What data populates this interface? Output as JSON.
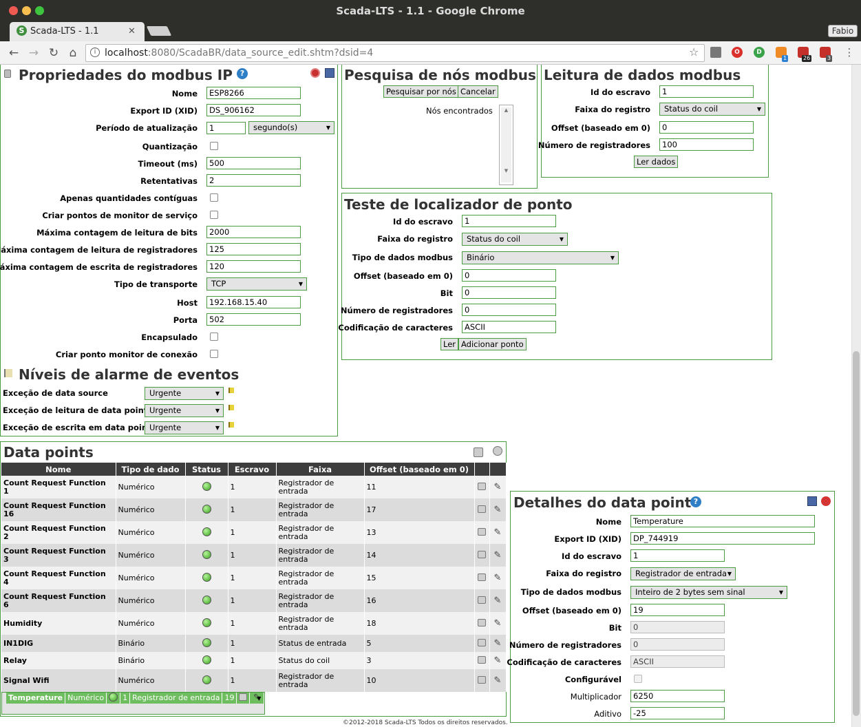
{
  "browser": {
    "window_title": "Scada-LTS - 1.1 - Google Chrome",
    "tab_title": "Scada-LTS - 1.1",
    "tab_favicon": "S",
    "user": "Fabio",
    "url_host": "localhost",
    "url_rest": ":8080/ScadaBR/data_source_edit.shtm?dsid=4",
    "extension_badges": [
      "1",
      "26",
      "3"
    ]
  },
  "props": {
    "title": "Propriedades do modbus IP",
    "fields": {
      "nome": {
        "label": "Nome",
        "value": "ESP8266"
      },
      "xid": {
        "label": "Export ID (XID)",
        "value": "DS_906162"
      },
      "periodo": {
        "label": "Período de atualização",
        "value": "1",
        "unit": "segundo(s)"
      },
      "quantizacao": {
        "label": "Quantização"
      },
      "timeout": {
        "label": "Timeout (ms)",
        "value": "500"
      },
      "retentativas": {
        "label": "Retentativas",
        "value": "2"
      },
      "contiguas": {
        "label": "Apenas quantidades contíguas"
      },
      "monitor": {
        "label": "Criar pontos de monitor de serviço"
      },
      "maxbits": {
        "label": "Máxima contagem de leitura de bits",
        "value": "2000"
      },
      "maxreg": {
        "label": "Máxima contagem de leitura de registradores",
        "value": "125"
      },
      "maxesc": {
        "label": "Máxima contagem de escrita de registradores",
        "value": "120"
      },
      "transporte": {
        "label": "Tipo de transporte",
        "value": "TCP"
      },
      "host": {
        "label": "Host",
        "value": "192.168.15.40"
      },
      "porta": {
        "label": "Porta",
        "value": "502"
      },
      "encapsulado": {
        "label": "Encapsulado"
      },
      "conexao": {
        "label": "Criar ponto monitor de conexão"
      }
    }
  },
  "alarms": {
    "title": "Níveis de alarme de eventos",
    "rows": [
      {
        "label": "Exceção de data source",
        "value": "Urgente"
      },
      {
        "label": "Exceção de leitura de data point",
        "value": "Urgente"
      },
      {
        "label": "Exceção de escrita em data point",
        "value": "Urgente"
      }
    ]
  },
  "search": {
    "title": "Pesquisa de nós modbus",
    "search_button": "Pesquisar por nós",
    "cancel_button": "Cancelar",
    "found_label": "Nós encontrados"
  },
  "read": {
    "title": "Leitura de dados modbus",
    "slave": {
      "label": "Id do escravo",
      "value": "1"
    },
    "range": {
      "label": "Faixa do registro",
      "value": "Status do coil"
    },
    "offset": {
      "label": "Offset (baseado em 0)",
      "value": "0"
    },
    "count": {
      "label": "Número de registradores",
      "value": "100"
    },
    "button": "Ler dados"
  },
  "locator": {
    "title": "Teste de localizador de ponto",
    "slave": {
      "label": "Id do escravo",
      "value": "1"
    },
    "range": {
      "label": "Faixa do registro",
      "value": "Status do coil"
    },
    "datatype": {
      "label": "Tipo de dados modbus",
      "value": "Binário"
    },
    "offset": {
      "label": "Offset (baseado em 0)",
      "value": "0"
    },
    "bit": {
      "label": "Bit",
      "value": "0"
    },
    "count": {
      "label": "Número de registradores",
      "value": "0"
    },
    "charset": {
      "label": "Codificação de caracteres",
      "value": "ASCII"
    },
    "read_button": "Ler",
    "add_button": "Adicionar ponto"
  },
  "datapoints": {
    "title": "Data points",
    "columns": [
      "Nome",
      "Tipo de dado",
      "Status",
      "Escravo",
      "Faixa",
      "Offset (baseado em 0)"
    ],
    "rows": [
      {
        "name": "Count Request Function 1",
        "type": "Numérico",
        "slave": "1",
        "range": "Registrador de entrada",
        "offset": "11"
      },
      {
        "name": "Count Request Function 16",
        "type": "Numérico",
        "slave": "1",
        "range": "Registrador de entrada",
        "offset": "17"
      },
      {
        "name": "Count Request Function 2",
        "type": "Numérico",
        "slave": "1",
        "range": "Registrador de entrada",
        "offset": "13"
      },
      {
        "name": "Count Request Function 3",
        "type": "Numérico",
        "slave": "1",
        "range": "Registrador de entrada",
        "offset": "14"
      },
      {
        "name": "Count Request Function 4",
        "type": "Numérico",
        "slave": "1",
        "range": "Registrador de entrada",
        "offset": "15"
      },
      {
        "name": "Count Request Function 6",
        "type": "Numérico",
        "slave": "1",
        "range": "Registrador de entrada",
        "offset": "16"
      },
      {
        "name": "Humidity",
        "type": "Numérico",
        "slave": "1",
        "range": "Registrador de entrada",
        "offset": "18"
      },
      {
        "name": "IN1DIG",
        "type": "Binário",
        "slave": "1",
        "range": "Status de entrada",
        "offset": "5"
      },
      {
        "name": "Relay",
        "type": "Binário",
        "slave": "1",
        "range": "Status do coil",
        "offset": "3"
      },
      {
        "name": "Signal Wifi",
        "type": "Numérico",
        "slave": "1",
        "range": "Registrador de entrada",
        "offset": "10"
      },
      {
        "name": "Temperature",
        "type": "Numérico",
        "slave": "1",
        "range": "Registrador de entrada",
        "offset": "19"
      }
    ]
  },
  "details": {
    "title": "Detalhes do data point",
    "nome": {
      "label": "Nome",
      "value": "Temperature"
    },
    "xid": {
      "label": "Export ID (XID)",
      "value": "DP_744919"
    },
    "slave": {
      "label": "Id do escravo",
      "value": "1"
    },
    "range": {
      "label": "Faixa do registro",
      "value": "Registrador de entrada"
    },
    "datatype": {
      "label": "Tipo de dados modbus",
      "value": "Inteiro de 2 bytes sem sinal"
    },
    "offset": {
      "label": "Offset (baseado em 0)",
      "value": "19"
    },
    "bit": {
      "label": "Bit",
      "value": "0"
    },
    "count": {
      "label": "Número de registradores",
      "value": "0"
    },
    "charset": {
      "label": "Codificação de caracteres",
      "value": "ASCII"
    },
    "configuravel": {
      "label": "Configurável"
    },
    "mult": {
      "label": "Multiplicador",
      "value": "6250"
    },
    "aditivo": {
      "label": "Aditivo",
      "value": "-25"
    }
  },
  "footer": "©2012-2018 Scada-LTS Todos os direitos reservados.",
  "colors": {
    "accent": "#4a9a41",
    "selected_row": "#6ebd5e",
    "header_bg": "#3d3d3d"
  }
}
